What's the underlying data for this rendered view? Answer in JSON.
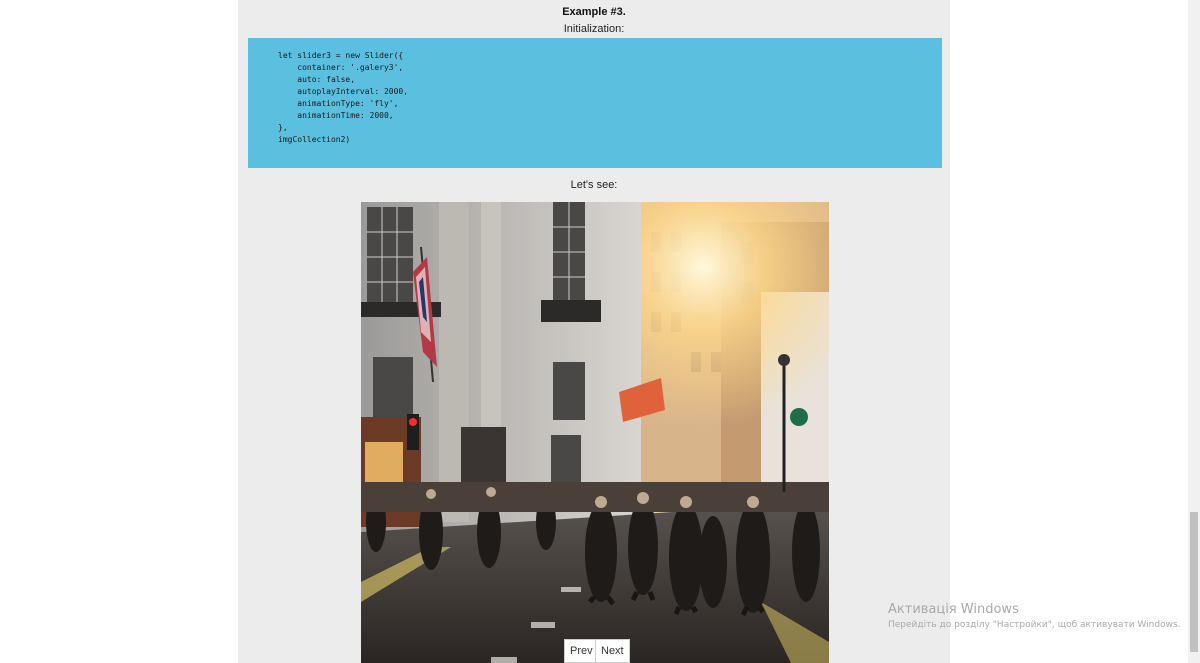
{
  "example": {
    "title": "Example #3.",
    "init_label": "Initialization:",
    "code": "let slider3 = new Slider({\n    container: '.galery3',\n    auto: false,\n    autoplayInterval: 2000,\n    animationType: 'fly',\n    animationTime: 2000,\n},\nimgCollection2)",
    "see_label": "Let's see:"
  },
  "slider": {
    "image_alt": "City street with crowd of people at sunset",
    "prev_label": "Prev",
    "next_label": "Next"
  },
  "watermark": {
    "title": "Активація Windows",
    "subtitle": "Перейдіть до розділу \"Настройки\", щоб активувати Windows."
  },
  "colors": {
    "code_background": "#5bbfe0",
    "column_background": "#ececec"
  }
}
